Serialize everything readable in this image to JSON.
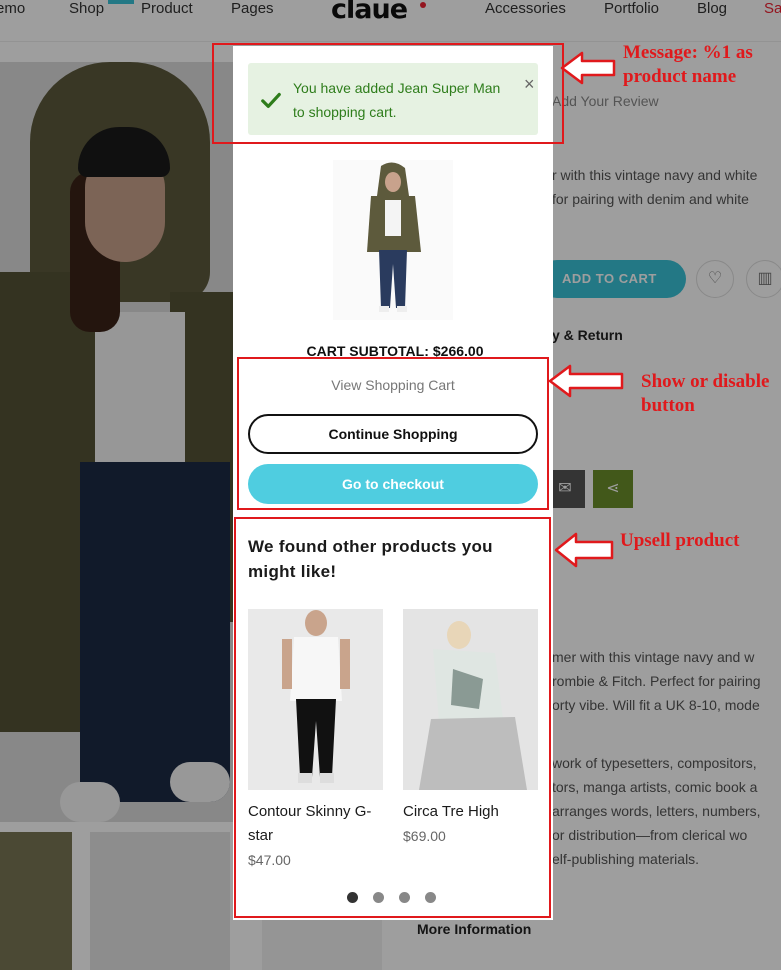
{
  "nav": {
    "items": [
      "emo",
      "Shop",
      "Product",
      "Pages",
      "Accessories",
      "Portfolio",
      "Blog",
      "Sa"
    ],
    "logo": "claue"
  },
  "background": {
    "review_link": "Add Your Review",
    "desc_line1": "r with this vintage navy and white",
    "desc_line2": "for pairing with denim and white",
    "add_to_cart": "ADD TO CART",
    "shipping_heading": "y & Return",
    "long_desc": [
      "mer with this vintage navy and w",
      "rombie & Fitch. Perfect for pairing",
      "orty vibe. Will fit a UK 8-10, mode",
      "",
      "work of typesetters, compositors,",
      "tors, manga artists, comic book a",
      "arranges words, letters, numbers,",
      "or distribution—from clerical wo",
      "elf-publishing materials."
    ],
    "more_info": "More Information"
  },
  "modal": {
    "message": "You have added Jean Super Man to shopping cart.",
    "close_glyph": "×",
    "subtotal_label": "CART SUBTOTAL:",
    "subtotal_value": "$266.00",
    "view_cart": "View Shopping Cart",
    "continue": "Continue Shopping",
    "checkout": "Go to checkout",
    "upsell_title": "We found other products you might like!",
    "products": [
      {
        "name": "Contour Skinny G-star",
        "price": "$47.00"
      },
      {
        "name": "Circa Tre High",
        "price": "$69.00"
      }
    ],
    "carousel_pages": 4,
    "carousel_active": 1
  },
  "annotations": {
    "message": "Message: %1 as product name",
    "buttons": "Show or disable button",
    "upsell": "Upsell product"
  },
  "colors": {
    "accent": "#4fcde0",
    "success_bg": "#e6f2e2",
    "success_text": "#2e7d1b",
    "annotation": "#e0191c"
  }
}
